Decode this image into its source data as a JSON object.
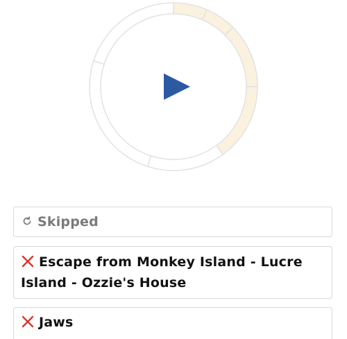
{
  "player": {
    "play_icon": "play-icon",
    "segments": [
      {
        "start": 0,
        "end": 6.5,
        "state": "played"
      },
      {
        "start": 6.5,
        "end": 12.5,
        "state": "played"
      },
      {
        "start": 12.5,
        "end": 25,
        "state": "played"
      },
      {
        "start": 25,
        "end": 40,
        "state": "played"
      },
      {
        "start": 40,
        "end": 55,
        "state": "empty"
      },
      {
        "start": 55,
        "end": 80,
        "state": "empty"
      },
      {
        "start": 80,
        "end": 100,
        "state": "empty"
      }
    ],
    "colors": {
      "played": "#fbf1df",
      "empty": "#e2e2e2",
      "play": "#2b5aa2"
    }
  },
  "guesses": [
    {
      "status": "skipped",
      "icon": "skip-icon",
      "text": "Skipped"
    },
    {
      "status": "wrong",
      "icon": "close-icon",
      "text": "Escape from Monkey Island - Lucre Island - Ozzie's House"
    },
    {
      "status": "wrong",
      "icon": "close-icon",
      "text": "Jaws"
    }
  ],
  "colors": {
    "wrong_icon": "#d9362b",
    "skipped_text": "#7a7a7a"
  }
}
